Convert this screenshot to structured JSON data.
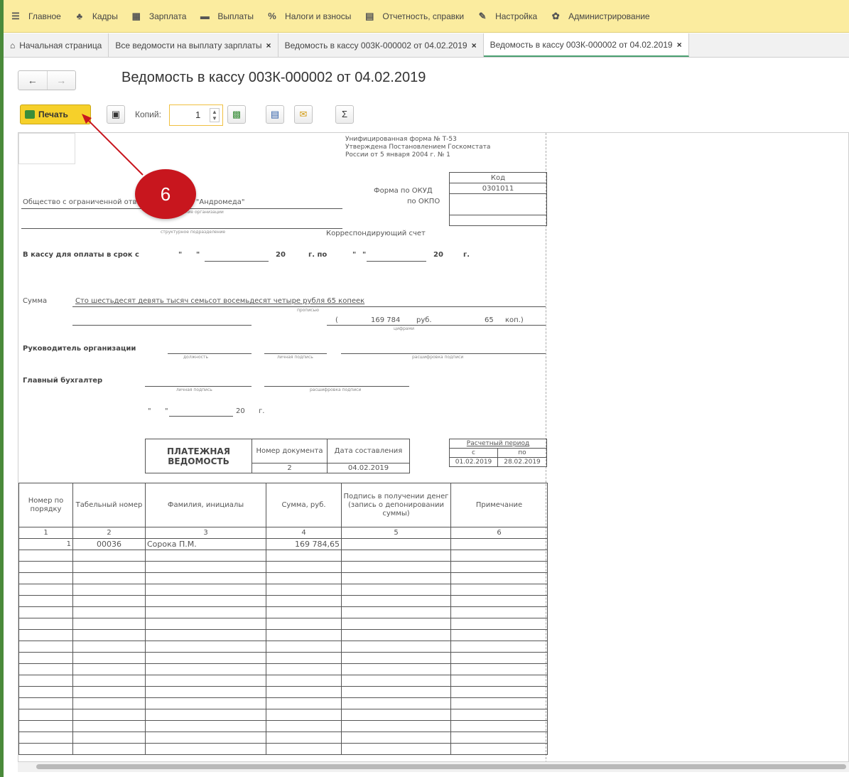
{
  "menu": [
    {
      "icon": "hamburger-icon",
      "glyph": "☰",
      "label": "Главное"
    },
    {
      "icon": "people-icon",
      "glyph": "♣",
      "label": "Кадры"
    },
    {
      "icon": "calculator-icon",
      "glyph": "▦",
      "label": "Зарплата"
    },
    {
      "icon": "card-icon",
      "glyph": "▬",
      "label": "Выплаты"
    },
    {
      "icon": "percent-icon",
      "glyph": "%",
      "label": "Налоги и взносы"
    },
    {
      "icon": "report-icon",
      "glyph": "▤",
      "label": "Отчетность, справки"
    },
    {
      "icon": "wrench-icon",
      "glyph": "✎",
      "label": "Настройка"
    },
    {
      "icon": "gear-icon",
      "glyph": "✿",
      "label": "Администрирование"
    }
  ],
  "tabs": [
    {
      "label": "Начальная страница"
    },
    {
      "label": "Все ведомости на выплату зарплаты"
    },
    {
      "label": "Ведомость в кассу 003К-000002 от 04.02.2019"
    },
    {
      "label": "Ведомость в кассу 003К-000002 от 04.02.2019"
    }
  ],
  "nav": {
    "back": "←",
    "forward": "→"
  },
  "title": "Ведомость в кассу 003К-000002 от 04.02.2019",
  "toolbar": {
    "print_label": "Печать",
    "copies_label": "Копий:",
    "copies_value": "1",
    "preview_glyph": "🔍",
    "sum_glyph": "Σ"
  },
  "annotation": {
    "number": "6"
  },
  "doc": {
    "form_header": [
      "Унифицированная форма № Т-53",
      "Утверждена Постановлением Госкомстата",
      "России от 5 января 2004 г. № 1"
    ],
    "code_header": "Код",
    "okud_label": "Форма по ОКУД",
    "okud_value": "0301011",
    "okpo_label": "по ОКПО",
    "org_name": "Общество с ограниченной ответственностью \"Андромеда\"",
    "org_caption": "наименование организации",
    "dept_caption": "структурное подразделение",
    "corr_account": "Корреспондирующий счет",
    "pay_term": "В кассу для оплаты в срок с",
    "pay_term_20a": "20",
    "pay_term_g_po": "г. по",
    "pay_term_20b": "20",
    "pay_term_g": "г.",
    "quote_open": "\"",
    "quote_close": "\"",
    "sum_label": "Сумма",
    "sum_words": "Сто шестьдесят девять тысяч семьсот восемьдесят четыре рубля 65 копеек",
    "sum_words_caption": "прописью",
    "sum_paren_open": "(",
    "sum_rub": "169 784",
    "sum_rub_label": "руб.",
    "sum_kop": "65",
    "sum_kop_label": "коп.)",
    "sum_digits_caption": "цифрами",
    "head_label": "Руководитель организации",
    "head_cap1": "должность",
    "head_cap2": "личная подпись",
    "head_cap3": "расшифровка подписи",
    "accountant_label": "Главный бухгалтер",
    "acc_cap1": "личная подпись",
    "acc_cap2": "расшифровка подписи",
    "date_20": "20",
    "date_g": "г.",
    "pv_title": [
      "ПЛАТЕЖНАЯ",
      "ВЕДОМОСТЬ"
    ],
    "pv_doc_num_header": "Номер документа",
    "pv_date_header": "Дата составления",
    "pv_doc_num": "2",
    "pv_date": "04.02.2019",
    "period_header": "Расчетный период",
    "period_from_label": "с",
    "period_to_label": "по",
    "period_from": "01.02.2019",
    "period_to": "28.02.2019",
    "table_headers": [
      "Номер по порядку",
      "Табельный номер",
      "Фамилия, инициалы",
      "Сумма, руб.",
      "Подпись в получении денег (запись о депонировании суммы)",
      "Примечание"
    ],
    "table_nums": [
      "1",
      "2",
      "3",
      "4",
      "5",
      "6"
    ],
    "rows": [
      [
        "1",
        "00036",
        "Сорока П.М.",
        "169 784,65",
        "",
        ""
      ]
    ]
  }
}
